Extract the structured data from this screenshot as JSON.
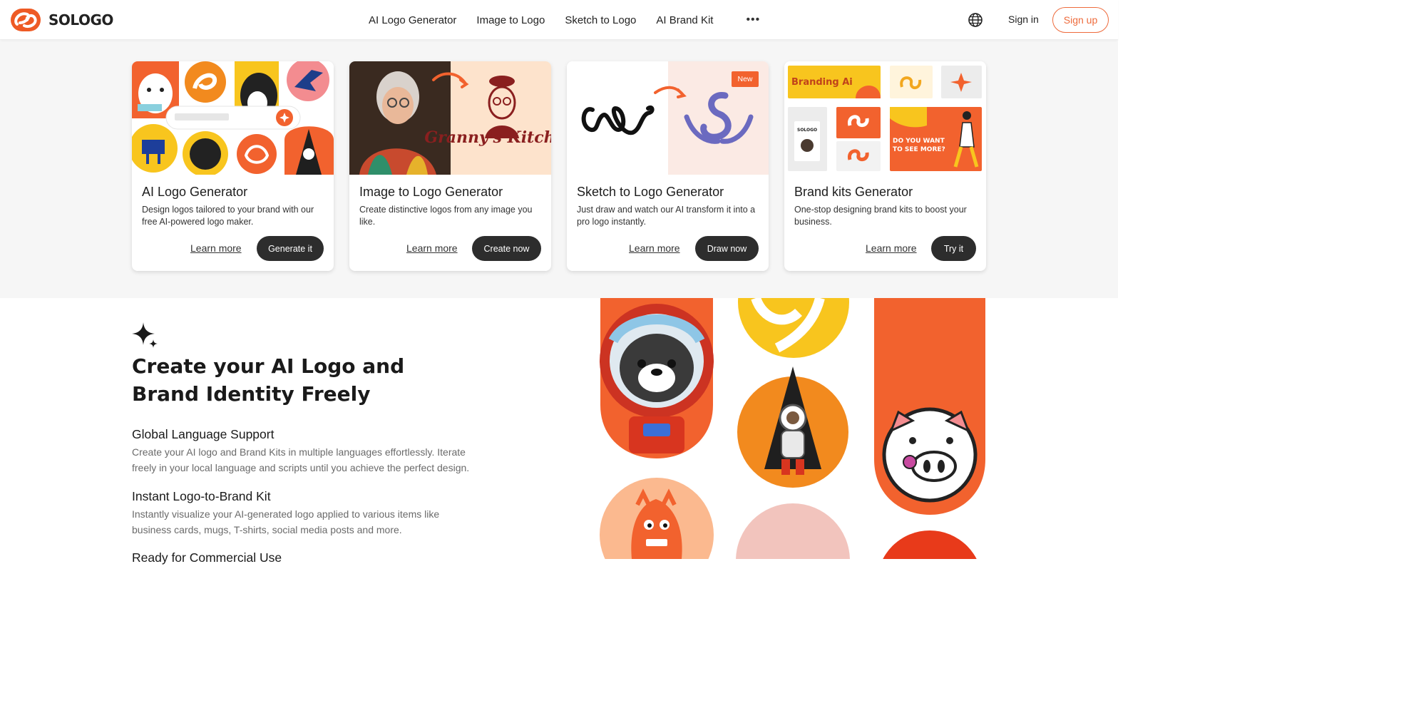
{
  "header": {
    "brand": "SOLOGO",
    "nav": [
      "AI Logo Generator",
      "Image to Logo",
      "Sketch to Logo",
      "AI Brand Kit"
    ],
    "more": "•••",
    "signin": "Sign in",
    "signup": "Sign up"
  },
  "cards": [
    {
      "title": "AI Logo Generator",
      "desc": "Design logos tailored to your brand with our free AI-powered logo maker.",
      "learn": "Learn more",
      "cta": "Generate it"
    },
    {
      "title": "Image to Logo Generator",
      "desc": "Create distinctive logos from any image you like.",
      "learn": "Learn more",
      "cta": "Create now",
      "art_text": "Granny's Kitchen"
    },
    {
      "title": "Sketch to Logo Generator",
      "desc": "Just draw and watch our AI transform it into a pro logo instantly.",
      "learn": "Learn more",
      "cta": "Draw now",
      "badge": "New"
    },
    {
      "title": "Brand kits Generator",
      "desc": "One-stop designing brand kits to boost your business.",
      "learn": "Learn more",
      "cta": "Try it",
      "art_brand": "Branding Ai",
      "art_logo": "SOLOGO",
      "art_question": "DO YOU WANT TO SEE MORE?"
    }
  ],
  "section": {
    "headline": "Create your AI Logo and Brand Identity Freely",
    "features": [
      {
        "title": "Global Language Support",
        "desc": "Create your AI logo and Brand Kits in multiple languages effortlessly. Iterate freely in your local language and scripts until you achieve the perfect design."
      },
      {
        "title": "Instant Logo-to-Brand Kit",
        "desc": "Instantly visualize your AI-generated logo applied to various items like business cards, mugs, T-shirts, social media posts and more."
      },
      {
        "title": "Ready for Commercial Use",
        "desc": ""
      }
    ]
  },
  "colors": {
    "accent": "#ee6b3c",
    "dark_button": "#2d2d2d",
    "band_bg": "#f6f6f6"
  }
}
